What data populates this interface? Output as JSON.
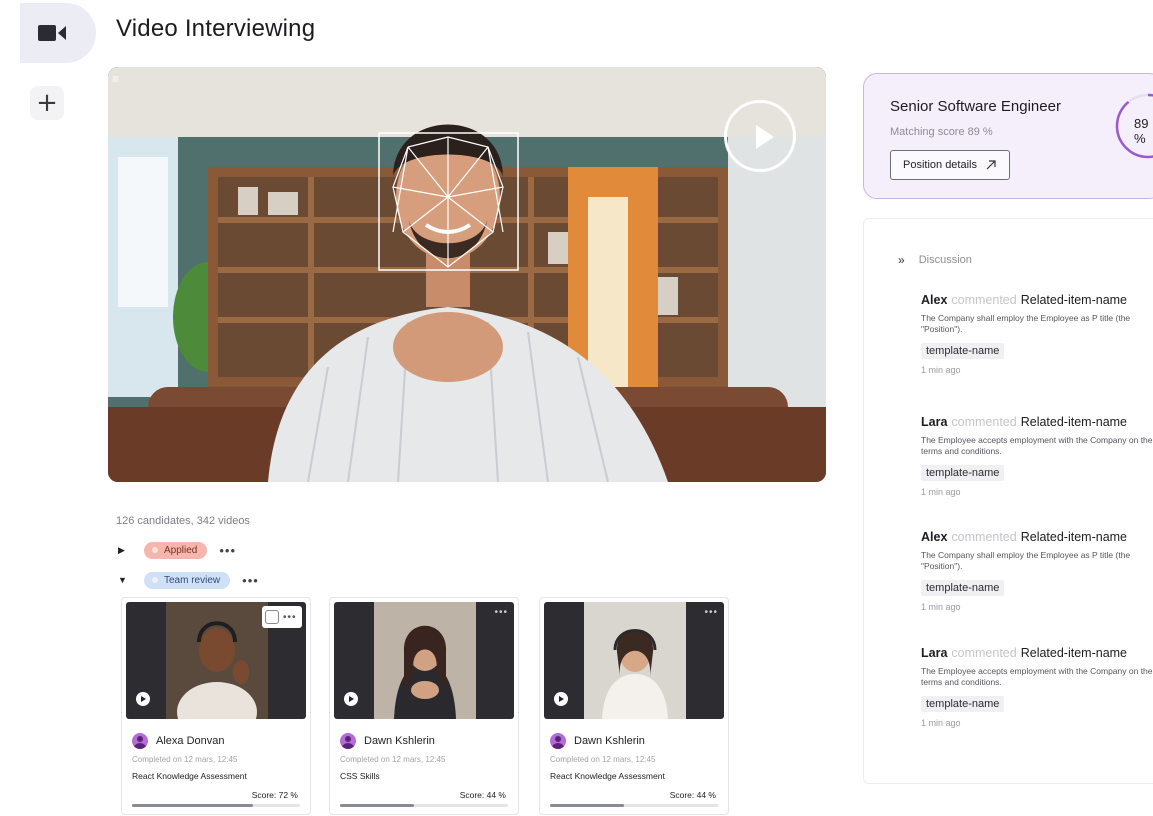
{
  "app": {
    "title": "Video Interviewing",
    "rail_active_icon": "video-camera-icon",
    "rail_add_icon": "plus-icon",
    "rail_add_label": "+"
  },
  "player": {
    "menu_icon": "≡",
    "play_icon": "play-icon"
  },
  "summary": "126 candidates, 342 videos",
  "groups": [
    {
      "label": "Applied",
      "expanded": false,
      "color": "#f7b6ad"
    },
    {
      "label": "Team review",
      "expanded": true,
      "color": "#cfe0f7"
    }
  ],
  "more_label": "•••",
  "candidates": [
    {
      "name": "Alexa Donvan",
      "completed": "Completed on 12 mars, 12:45",
      "assessment": "React Knowledge Assessment",
      "score_label": "Score: 72 %",
      "score": 72
    },
    {
      "name": "Dawn Kshlerin",
      "completed": "Completed on 12 mars, 12:45",
      "assessment": "CSS Skills",
      "score_label": "Score: 44 %",
      "score": 44
    },
    {
      "name": "Dawn Kshlerin",
      "completed": "Completed on 12 mars, 12:45",
      "assessment": "React Knowledge Assessment",
      "score_label": "Score: 44 %",
      "score": 44
    }
  ],
  "position": {
    "title": "Senior Software Engineer",
    "matching": "Matching score 89 %",
    "details_button": "Position details",
    "details_icon": "arrow-up-right-icon",
    "score_label": "89 %",
    "score": 89,
    "accent": "#9b59d0"
  },
  "discussion": {
    "title": "Discussion",
    "toggle_icon": "»",
    "comments": [
      {
        "name": "Alex",
        "verb": "commented",
        "item": "Related-item-name",
        "body": "The Company shall employ the Employee as P title (the \"Position\").",
        "tag": "template-name",
        "time": "1 min ago"
      },
      {
        "name": "Lara",
        "verb": "commented",
        "item": "Related-item-name",
        "body": "The Employee accepts employment with the Company on the terms and conditions.",
        "tag": "template-name",
        "time": "1 min ago"
      },
      {
        "name": "Alex",
        "verb": "commented",
        "item": "Related-item-name",
        "body": "The Company shall employ the Employee as P title (the \"Position\").",
        "tag": "template-name",
        "time": "1 min ago"
      },
      {
        "name": "Lara",
        "verb": "commented",
        "item": "Related-item-name",
        "body": "The Employee accepts employment with the Company on the terms and conditions.",
        "tag": "template-name",
        "time": "1 min ago"
      }
    ]
  }
}
